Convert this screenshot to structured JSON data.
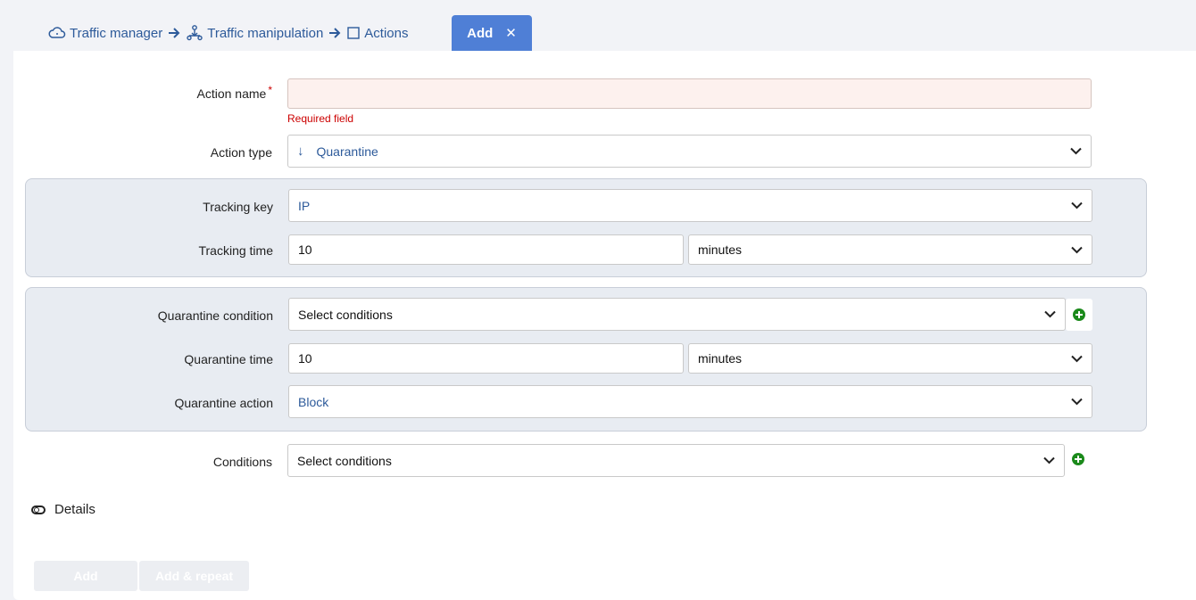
{
  "breadcrumb": {
    "items": [
      {
        "label": "Traffic manager",
        "icon": "cloud-icon"
      },
      {
        "label": "Traffic manipulation",
        "icon": "network-icon"
      },
      {
        "label": "Actions",
        "icon": "square-icon"
      }
    ]
  },
  "tab": {
    "label": "Add",
    "close": "✕"
  },
  "form": {
    "action_name": {
      "label": "Action name",
      "required_mark": "*",
      "value": "",
      "error": "Required field"
    },
    "action_type": {
      "label": "Action type",
      "icon": "↓",
      "value": "Quarantine"
    },
    "tracking_key": {
      "label": "Tracking key",
      "value": "IP"
    },
    "tracking_time": {
      "label": "Tracking time",
      "value": "10",
      "unit": "minutes"
    },
    "quarantine_condition": {
      "label": "Quarantine condition",
      "value": "Select conditions"
    },
    "quarantine_time": {
      "label": "Quarantine time",
      "value": "10",
      "unit": "minutes"
    },
    "quarantine_action": {
      "label": "Quarantine action",
      "value": "Block"
    },
    "conditions": {
      "label": "Conditions",
      "value": "Select conditions"
    }
  },
  "details": {
    "label": "Details"
  },
  "buttons": {
    "add": "Add",
    "add_repeat": "Add & repeat"
  },
  "colors": {
    "accent": "#4f7fd6",
    "link": "#2d5a9a",
    "error": "#cc0000",
    "add_green": "#1b8a1b",
    "group_bg": "#e8ecf2"
  }
}
